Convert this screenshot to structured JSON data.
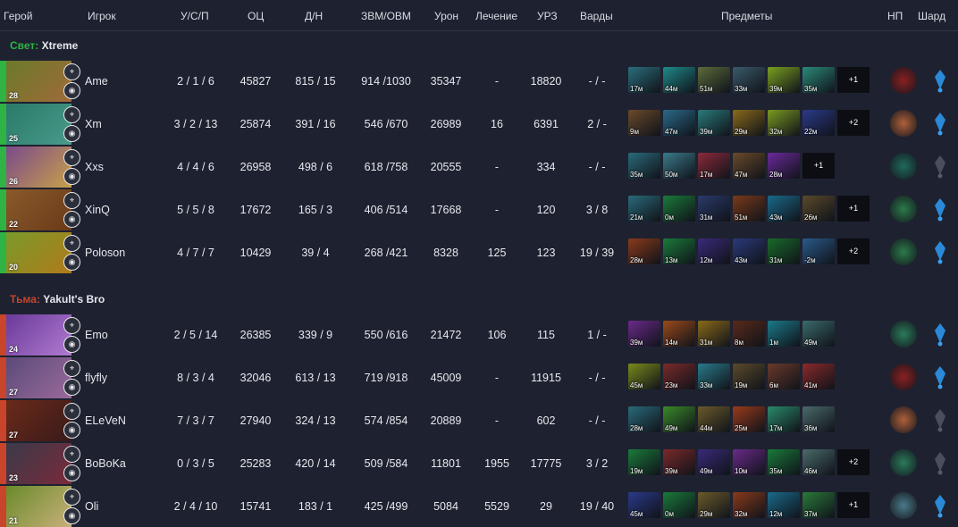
{
  "header": {
    "hero": "Герой",
    "player": "Игрок",
    "kda": "У/С/П",
    "nw": "ОЦ",
    "lhdn": "Д/Н",
    "gpmxpm": "ЗВМ/ОВМ",
    "dmg": "Урон",
    "heal": "Лечение",
    "bld": "УРЗ",
    "wards": "Варды",
    "items": "Предметы",
    "np": "НП",
    "shard": "Шард"
  },
  "colors": {
    "radiant": "#2fb344",
    "dire": "#c8442b",
    "background": "#1e2230"
  },
  "teams": [
    {
      "side": "Свет:",
      "name": "Xtreme",
      "players": [
        {
          "level": "28",
          "name": "Ame",
          "kda": "2 / 1 / 6",
          "nw": "45827",
          "lhdn": "815 / 15",
          "gpmxpm": "914 /1030",
          "dmg": "35347",
          "heal": "-",
          "bld": "18820",
          "wards": "- / -",
          "items": [
            {
              "t": "17м",
              "c": "#2a6e7c"
            },
            {
              "t": "44м",
              "c": "#1f8a8a"
            },
            {
              "t": "51м",
              "c": "#5a6b3a"
            },
            {
              "t": "33м",
              "c": "#3a5a6a"
            },
            {
              "t": "39м",
              "c": "#7aa020"
            },
            {
              "t": "35м",
              "c": "#2a8a7a"
            }
          ],
          "more": "+1",
          "np": "#8a2020",
          "shard": "on"
        },
        {
          "level": "25",
          "name": "Xm",
          "kda": "3 / 2 / 13",
          "nw": "25874",
          "lhdn": "391 / 16",
          "gpmxpm": "546 /670",
          "dmg": "26989",
          "heal": "16",
          "bld": "6391",
          "wards": "2 / -",
          "items": [
            {
              "t": "9м",
              "c": "#6a4a2a"
            },
            {
              "t": "47м",
              "c": "#2a6a8a"
            },
            {
              "t": "39м",
              "c": "#2a7a7a"
            },
            {
              "t": "29м",
              "c": "#8a6a1a"
            },
            {
              "t": "32м",
              "c": "#7a9a20"
            },
            {
              "t": "22м",
              "c": "#2a3a8a"
            }
          ],
          "more": "+2",
          "np": "#b0603a",
          "shard": "on"
        },
        {
          "level": "26",
          "name": "Xxs",
          "kda": "4 / 4 / 6",
          "nw": "26958",
          "lhdn": "498 / 6",
          "gpmxpm": "618 /758",
          "dmg": "20555",
          "heal": "-",
          "bld": "334",
          "wards": "- / -",
          "items": [
            {
              "t": "35м",
              "c": "#2a6a7a"
            },
            {
              "t": "50м",
              "c": "#3a7a8a"
            },
            {
              "t": "17м",
              "c": "#8a2a3a"
            },
            {
              "t": "47м",
              "c": "#6a4a2a"
            },
            {
              "t": "28м",
              "c": "#6a2a9a"
            }
          ],
          "more": "+1",
          "np": "#1f6a5a",
          "shard": "off"
        },
        {
          "level": "22",
          "name": "XinQ",
          "kda": "5 / 5 / 8",
          "nw": "17672",
          "lhdn": "165 / 3",
          "gpmxpm": "406 /514",
          "dmg": "17668",
          "heal": "-",
          "bld": "120",
          "wards": "3 / 8",
          "items": [
            {
              "t": "21м",
              "c": "#2a6a7a"
            },
            {
              "t": "0м",
              "c": "#1a7a3a"
            },
            {
              "t": "31м",
              "c": "#2a3a6a"
            },
            {
              "t": "51м",
              "c": "#7a3a1a"
            },
            {
              "t": "43м",
              "c": "#1a6a8a"
            },
            {
              "t": "26м",
              "c": "#5a4a2a"
            }
          ],
          "more": "+1",
          "np": "#2a7a4a",
          "shard": "on"
        },
        {
          "level": "20",
          "name": "Poloson",
          "kda": "4 / 7 / 7",
          "nw": "10429",
          "lhdn": "39 / 4",
          "gpmxpm": "268 /421",
          "dmg": "8328",
          "heal": "125",
          "bld": "123",
          "wards": "19 / 39",
          "items": [
            {
              "t": "28м",
              "c": "#8a3a1a"
            },
            {
              "t": "13м",
              "c": "#1a7a3a"
            },
            {
              "t": "12м",
              "c": "#3a2a7a"
            },
            {
              "t": "43м",
              "c": "#2a3a7a"
            },
            {
              "t": "31м",
              "c": "#1a6a2a"
            },
            {
              "t": "-2м",
              "c": "#2a5a8a"
            }
          ],
          "more": "+2",
          "np": "#2a7a4a",
          "shard": "on"
        }
      ]
    },
    {
      "side": "Тьма:",
      "name": "Yakult's Bro",
      "players": [
        {
          "level": "24",
          "name": "Emo",
          "kda": "2 / 5 / 14",
          "nw": "26385",
          "lhdn": "339 / 9",
          "gpmxpm": "550 /616",
          "dmg": "21472",
          "heal": "106",
          "bld": "115",
          "wards": "1 / -",
          "items": [
            {
              "t": "39м",
              "c": "#6a2a8a"
            },
            {
              "t": "14м",
              "c": "#9a4a1a"
            },
            {
              "t": "31м",
              "c": "#8a6a1a"
            },
            {
              "t": "8м",
              "c": "#5a2a1a"
            },
            {
              "t": "1м",
              "c": "#1a7a8a"
            },
            {
              "t": "49м",
              "c": "#3a6a6a"
            }
          ],
          "more": "",
          "np": "#2a7a5a",
          "shard": "on"
        },
        {
          "level": "27",
          "name": "flyfly",
          "kda": "8 / 3 / 4",
          "nw": "32046",
          "lhdn": "613 / 13",
          "gpmxpm": "719 /918",
          "dmg": "45009",
          "heal": "-",
          "bld": "11915",
          "wards": "- / -",
          "items": [
            {
              "t": "45м",
              "c": "#7a8a1a"
            },
            {
              "t": "23м",
              "c": "#7a2a2a"
            },
            {
              "t": "33м",
              "c": "#2a7a8a"
            },
            {
              "t": "19м",
              "c": "#5a4a2a"
            },
            {
              "t": "6м",
              "c": "#6a3a2a"
            },
            {
              "t": "41м",
              "c": "#8a2a2a"
            }
          ],
          "more": "",
          "np": "#8a2020",
          "shard": "on"
        },
        {
          "level": "27",
          "name": "ELeVeN",
          "kda": "7 / 3 / 7",
          "nw": "27940",
          "lhdn": "324 / 13",
          "gpmxpm": "574 /854",
          "dmg": "20889",
          "heal": "-",
          "bld": "602",
          "wards": "- / -",
          "items": [
            {
              "t": "28м",
              "c": "#2a6a7a"
            },
            {
              "t": "49м",
              "c": "#3a8a2a"
            },
            {
              "t": "44м",
              "c": "#6a5a2a"
            },
            {
              "t": "25м",
              "c": "#9a3a1a"
            },
            {
              "t": "17м",
              "c": "#2a8a6a"
            },
            {
              "t": "36м",
              "c": "#4a6a6a"
            }
          ],
          "more": "",
          "np": "#b0603a",
          "shard": "off"
        },
        {
          "level": "23",
          "name": "BoBoKa",
          "kda": "0 / 3 / 5",
          "nw": "25283",
          "lhdn": "420 / 14",
          "gpmxpm": "509 /584",
          "dmg": "11801",
          "heal": "1955",
          "bld": "17775",
          "wards": "3 / 2",
          "items": [
            {
              "t": "19м",
              "c": "#1a7a3a"
            },
            {
              "t": "39м",
              "c": "#7a2a2a"
            },
            {
              "t": "49м",
              "c": "#3a2a7a"
            },
            {
              "t": "10м",
              "c": "#6a2a8a"
            },
            {
              "t": "35м",
              "c": "#1a7a3a"
            },
            {
              "t": "46м",
              "c": "#4a6a6a"
            }
          ],
          "more": "+2",
          "np": "#2a7a5a",
          "shard": "off"
        },
        {
          "level": "21",
          "name": "Oli",
          "kda": "2 / 4 / 10",
          "nw": "15741",
          "lhdn": "183 / 1",
          "gpmxpm": "425 /499",
          "dmg": "5084",
          "heal": "5529",
          "bld": "29",
          "wards": "19 / 40",
          "items": [
            {
              "t": "45м",
              "c": "#2a3a8a"
            },
            {
              "t": "0м",
              "c": "#1a7a3a"
            },
            {
              "t": "29м",
              "c": "#6a5a2a"
            },
            {
              "t": "32м",
              "c": "#8a3a1a"
            },
            {
              "t": "12м",
              "c": "#1a6a8a"
            },
            {
              "t": "37м",
              "c": "#2a7a3a"
            }
          ],
          "more": "+1",
          "np": "#4a7a8a",
          "shard": "on"
        }
      ]
    }
  ]
}
